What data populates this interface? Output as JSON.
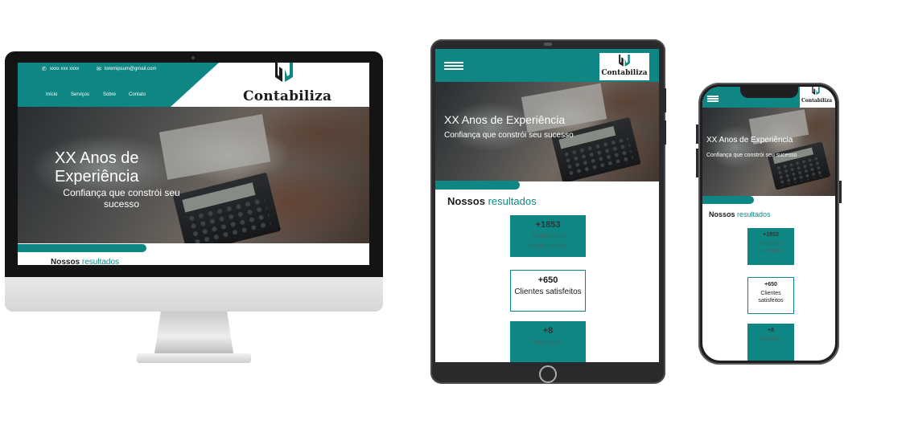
{
  "brand": {
    "name": "Contabiliza",
    "accent_color": "#0e8784"
  },
  "desktop": {
    "contact": {
      "phone_icon": "phone-icon",
      "phone": "xxxx xxx xxxx",
      "email_icon": "envelope-icon",
      "email": "loremipsum@gmail.com"
    },
    "nav": [
      "Início",
      "Serviços",
      "Sobre",
      "Contato"
    ],
    "hero_title": "XX Anos de Experiência",
    "hero_subtitle": "Confiança que constrói seu sucesso",
    "results_heading": "Nossos",
    "results_heading_highlight": "resultados"
  },
  "tablet": {
    "menu_icon": "hamburger-menu-icon",
    "hero_title": "XX Anos de Experiência",
    "hero_subtitle": "Confiança que constrói seu sucesso",
    "results_heading": "Nossos",
    "results_heading_highlight": "resultados",
    "cards": [
      {
        "number": "+1853",
        "label": "Trabalhos concluídos",
        "style": "teal"
      },
      {
        "number": "+650",
        "label": "Clientes satisfeitos",
        "style": "outline"
      },
      {
        "number": "+8",
        "label": "Equipes",
        "style": "teal"
      }
    ]
  },
  "phone": {
    "hero_title": "XX Anos de Experiência",
    "hero_subtitle": "Confiança que constrói seu sucesso",
    "results_heading": "Nossos",
    "results_heading_highlight": "resultados",
    "cards": [
      {
        "number": "+1853",
        "label": "Trabalhos concluídos",
        "style": "teal"
      },
      {
        "number": "+650",
        "label": "Clientes satisfeitos",
        "style": "outline"
      },
      {
        "number": "+8",
        "label": "Equipes",
        "style": "teal"
      }
    ]
  }
}
